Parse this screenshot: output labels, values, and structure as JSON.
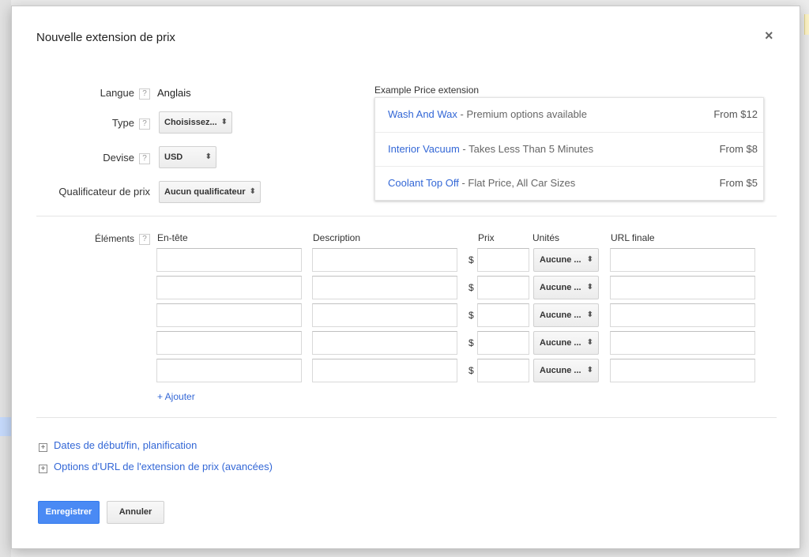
{
  "dialog": {
    "title": "Nouvelle extension de prix",
    "close_label": "×"
  },
  "help_label": "?",
  "form": {
    "language": {
      "label": "Langue",
      "value": "Anglais"
    },
    "type": {
      "label": "Type",
      "value": "Choisissez..."
    },
    "currency": {
      "label": "Devise",
      "value": "USD"
    },
    "qualifier": {
      "label": "Qualificateur de prix",
      "value": "Aucun qualificateur"
    },
    "items_label": "Éléments"
  },
  "example": {
    "title": "Example Price extension",
    "rows": [
      {
        "link": "Wash And Wax",
        "desc": " - Premium options available",
        "price": "From $12"
      },
      {
        "link": "Interior Vacuum",
        "desc": " - Takes Less Than 5 Minutes",
        "price": "From $8"
      },
      {
        "link": "Coolant Top Off",
        "desc": " - Flat Price, All Car Sizes",
        "price": "From $5"
      }
    ]
  },
  "table": {
    "headers": {
      "header": "En-tête",
      "description": "Description",
      "price": "Prix",
      "units": "Unités",
      "final_url": "URL finale"
    },
    "currency_symbol": "$",
    "unit_value": "Aucune ...",
    "row_count": 5
  },
  "add_label": "+ Ajouter",
  "expanders": {
    "dates": "Dates de début/fin, planification",
    "url_options": "Options d'URL de l'extension de prix (avancées)"
  },
  "buttons": {
    "save": "Enregistrer",
    "cancel": "Annuler"
  },
  "icons": {
    "select_arrows": "up-down-arrows-icon",
    "expand": "plus-box-icon",
    "close": "close-icon",
    "help": "help-icon"
  },
  "colors": {
    "link": "#3367d6",
    "primary_button": "#4a8af4"
  }
}
